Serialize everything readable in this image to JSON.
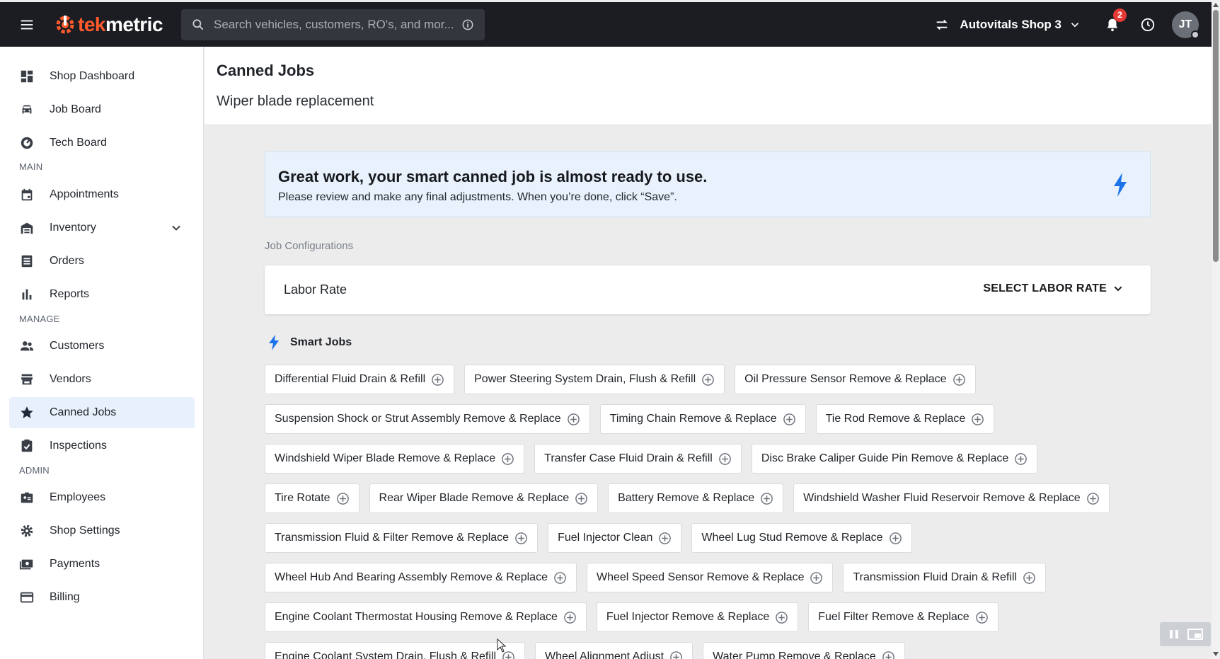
{
  "topbar": {
    "logo_prefix": "tek",
    "logo_suffix": "metric",
    "search_placeholder": "Search vehicles, customers, RO's, and mor...",
    "shop_name": "Autovitals Shop 3",
    "notification_count": "2",
    "avatar_initials": "JT"
  },
  "sidebar": {
    "items": [
      {
        "label": "Shop Dashboard",
        "icon": "dashboard-icon"
      },
      {
        "label": "Job Board",
        "icon": "car-icon"
      },
      {
        "label": "Tech Board",
        "icon": "gauge-icon"
      },
      {
        "label": "Appointments",
        "icon": "calendar-icon"
      },
      {
        "label": "Inventory",
        "icon": "warehouse-icon"
      },
      {
        "label": "Orders",
        "icon": "list-icon"
      },
      {
        "label": "Reports",
        "icon": "bar-chart-icon"
      },
      {
        "label": "Customers",
        "icon": "people-icon"
      },
      {
        "label": "Vendors",
        "icon": "store-icon"
      },
      {
        "label": "Canned Jobs",
        "icon": "star-icon"
      },
      {
        "label": "Inspections",
        "icon": "clipboard-check-icon"
      },
      {
        "label": "Employees",
        "icon": "badge-icon"
      },
      {
        "label": "Shop Settings",
        "icon": "gear-icon"
      },
      {
        "label": "Payments",
        "icon": "money-icon"
      },
      {
        "label": "Billing",
        "icon": "credit-card-icon"
      }
    ],
    "sections": {
      "main": "MAIN",
      "manage": "MANAGE",
      "admin": "ADMIN"
    },
    "active": "Canned Jobs"
  },
  "header": {
    "title": "Canned Jobs",
    "subtitle": "Wiper blade replacement"
  },
  "banner": {
    "title": "Great work, your smart canned job is almost ready to use.",
    "text": "Please review and make any final adjustments. When you’re done, click “Save”."
  },
  "config": {
    "section_label": "Job Configurations",
    "labor_rate_label": "Labor Rate",
    "labor_rate_select": "SELECT LABOR RATE"
  },
  "smart_jobs": {
    "title": "Smart Jobs",
    "rows": [
      [
        "Differential Fluid Drain & Refill",
        "Power Steering System Drain, Flush & Refill",
        "Oil Pressure Sensor Remove & Replace"
      ],
      [
        "Suspension Shock or Strut Assembly Remove & Replace",
        "Timing Chain Remove & Replace",
        "Tie Rod Remove & Replace"
      ],
      [
        "Windshield Wiper Blade Remove & Replace",
        "Transfer Case Fluid Drain & Refill",
        "Disc Brake Caliper Guide Pin Remove & Replace"
      ],
      [
        "Tire Rotate",
        "Rear Wiper Blade Remove & Replace",
        "Battery Remove & Replace",
        "Windshield Washer Fluid Reservoir Remove & Replace"
      ],
      [
        "Transmission Fluid & Filter Remove & Replace",
        "Fuel Injector Clean",
        "Wheel Lug Stud Remove & Replace"
      ],
      [
        "Wheel Hub And Bearing Assembly Remove & Replace",
        "Wheel Speed Sensor Remove & Replace",
        "Transmission Fluid Drain & Refill"
      ],
      [
        "Engine Coolant Thermostat Housing Remove & Replace",
        "Fuel Injector Remove & Replace",
        "Fuel Filter Remove & Replace"
      ],
      [
        "Engine Coolant System Drain, Flush & Refill",
        "Wheel Alignment Adjust",
        "Water Pump Remove & Replace"
      ]
    ]
  },
  "colors": {
    "topbar_bg": "#1b1d22",
    "brand_accent": "#ff5a2c",
    "bolt_blue": "#1a73e8",
    "active_nav_bg": "#e8f0fb",
    "banner_bg": "#e8f1fc",
    "badge_red": "#e53935"
  }
}
